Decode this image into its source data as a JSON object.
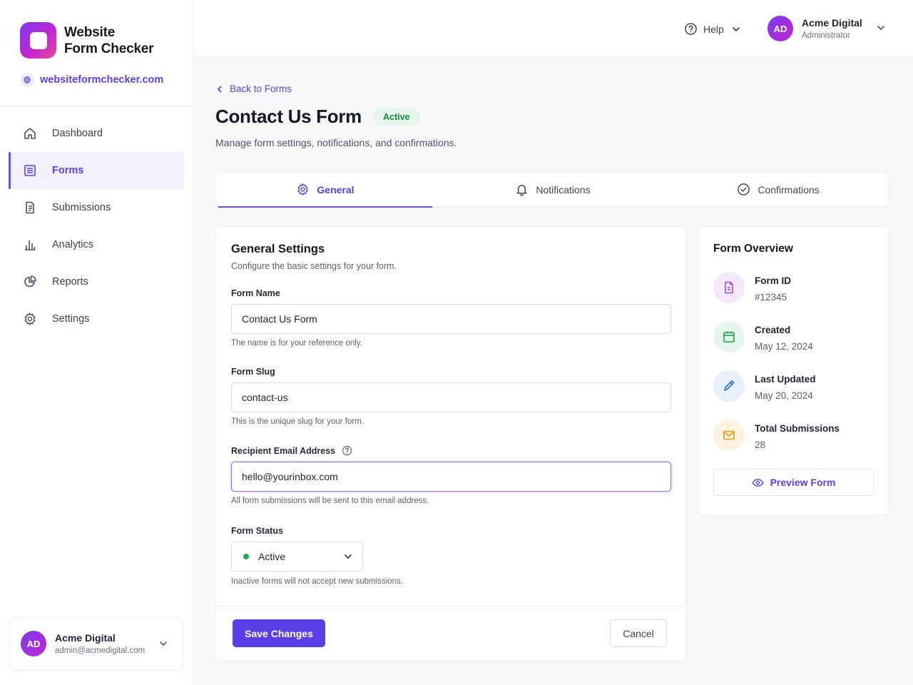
{
  "brand": {
    "name_line1": "Website",
    "name_line2": "Form Checker",
    "domain": "websiteformchecker.com"
  },
  "sidebar": {
    "items": [
      {
        "label": "Dashboard",
        "icon": "home-icon",
        "active": false
      },
      {
        "label": "Forms",
        "icon": "form-icon",
        "active": true
      },
      {
        "label": "Submissions",
        "icon": "document-icon",
        "active": false
      },
      {
        "label": "Analytics",
        "icon": "bar-chart-icon",
        "active": false
      },
      {
        "label": "Reports",
        "icon": "pie-chart-icon",
        "active": false
      },
      {
        "label": "Settings",
        "icon": "gear-icon",
        "active": false
      }
    ],
    "user": {
      "initials": "AD",
      "name": "Acme Digital",
      "email": "admin@acmedigital.com"
    }
  },
  "header": {
    "help_label": "Help",
    "account": {
      "initials": "AD",
      "name": "Acme Digital",
      "role": "Administrator"
    }
  },
  "page": {
    "back_label": "Back to Forms",
    "title": "Contact Us Form",
    "status": "Active",
    "subtitle": "Manage form settings, notifications, and confirmations."
  },
  "tabs": [
    {
      "label": "General",
      "icon": "gear-icon",
      "active": true
    },
    {
      "label": "Notifications",
      "icon": "bell-icon",
      "active": false
    },
    {
      "label": "Confirmations",
      "icon": "check-circle-icon",
      "active": false
    }
  ],
  "general": {
    "title": "General Settings",
    "subtitle": "Configure the basic settings for your form.",
    "form_name": {
      "label": "Form Name",
      "value": "Contact Us Form",
      "hint": "The name is for your reference only."
    },
    "form_slug": {
      "label": "Form Slug",
      "value": "contact-us",
      "hint": "This is the unique slug for your form."
    },
    "recipient_email": {
      "label": "Recipient Email Address",
      "value": "hello@yourinbox.com",
      "hint": "All form submissions will be sent to this email address."
    },
    "form_status": {
      "label": "Form Status",
      "value": "Active",
      "hint": "Inactive forms will not accept new submissions."
    },
    "save_label": "Save Changes",
    "cancel_label": "Cancel"
  },
  "overview": {
    "title": "Form Overview",
    "items": [
      {
        "label": "Form ID",
        "value": "#12345",
        "icon": "file-icon",
        "color": "#9b4dd6",
        "bg": "#f3e8fc"
      },
      {
        "label": "Created",
        "value": "May 12, 2024",
        "icon": "calendar-icon",
        "color": "#1f9d4c",
        "bg": "#e6f6ec"
      },
      {
        "label": "Last Updated",
        "value": "May 20, 2024",
        "icon": "pencil-icon",
        "color": "#2f6fe0",
        "bg": "#e8f0fd"
      },
      {
        "label": "Total Submissions",
        "value": "28",
        "icon": "mail-icon",
        "color": "#e59b12",
        "bg": "#fdf3e0"
      }
    ],
    "preview_label": "Preview Form"
  },
  "colors": {
    "accent": "#5b3ee5",
    "success": "#1bb04c"
  }
}
